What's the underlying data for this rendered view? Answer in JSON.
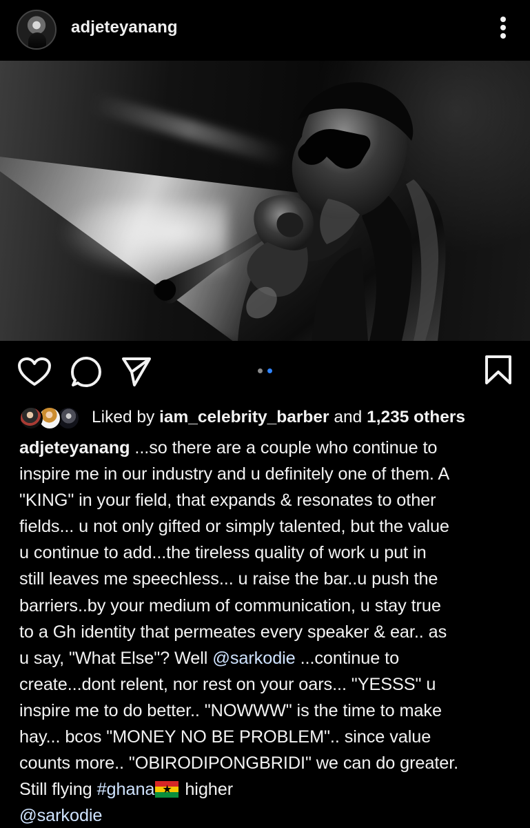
{
  "post": {
    "username": "adjeteyanang",
    "likes": {
      "prefix": "Liked by ",
      "liker": "iam_celebrity_barber",
      "connector": " and ",
      "count_text": "1,235 others"
    },
    "caption": {
      "lines": [
        {
          "user": "adjeteyanang",
          "text": " ...so there are a couple who continue to"
        },
        {
          "text": "inspire me in our industry and u definitely one of them. A"
        },
        {
          "text": "\"KING\" in your field, that expands & resonates to other"
        },
        {
          "text": "fields... u not only gifted or simply talented, but the value"
        },
        {
          "text": "u continue to add...the tireless quality of work u put in"
        },
        {
          "text": "still leaves me speechless... u raise the bar..u push the"
        },
        {
          "text": "barriers..by your medium of communication, u stay true"
        },
        {
          "text": "to a Gh identity that permeates every speaker & ear.. as"
        },
        {
          "before": "u say, \"What Else\"? Well ",
          "mention": "@sarkodie",
          "after": " ...continue to"
        },
        {
          "text": "create...dont relent, nor rest on your oars... \"YESSS\" u"
        },
        {
          "text": "inspire me to do better.. \"NOWWW\" is the time to make"
        },
        {
          "text": "hay... bcos \"MONEY NO BE PROBLEM\".. since value"
        },
        {
          "text": "counts more.. \"OBIRODIPONGBRIDI\" we can do greater."
        },
        {
          "before": "Still flying ",
          "hashtag": "#ghana",
          "after": " higher"
        },
        {
          "mention": "@sarkodie"
        }
      ]
    },
    "carousel": {
      "current": 2,
      "total": 2,
      "active_color": "#2f84ff",
      "inactive_color": "#8a8a8a"
    },
    "icons": {
      "avatar": "profile-avatar",
      "more": "more-options-icon",
      "like": "heart-icon",
      "comment": "comment-icon",
      "share": "share-icon",
      "save": "bookmark-icon",
      "flag": "ghana-flag"
    }
  }
}
